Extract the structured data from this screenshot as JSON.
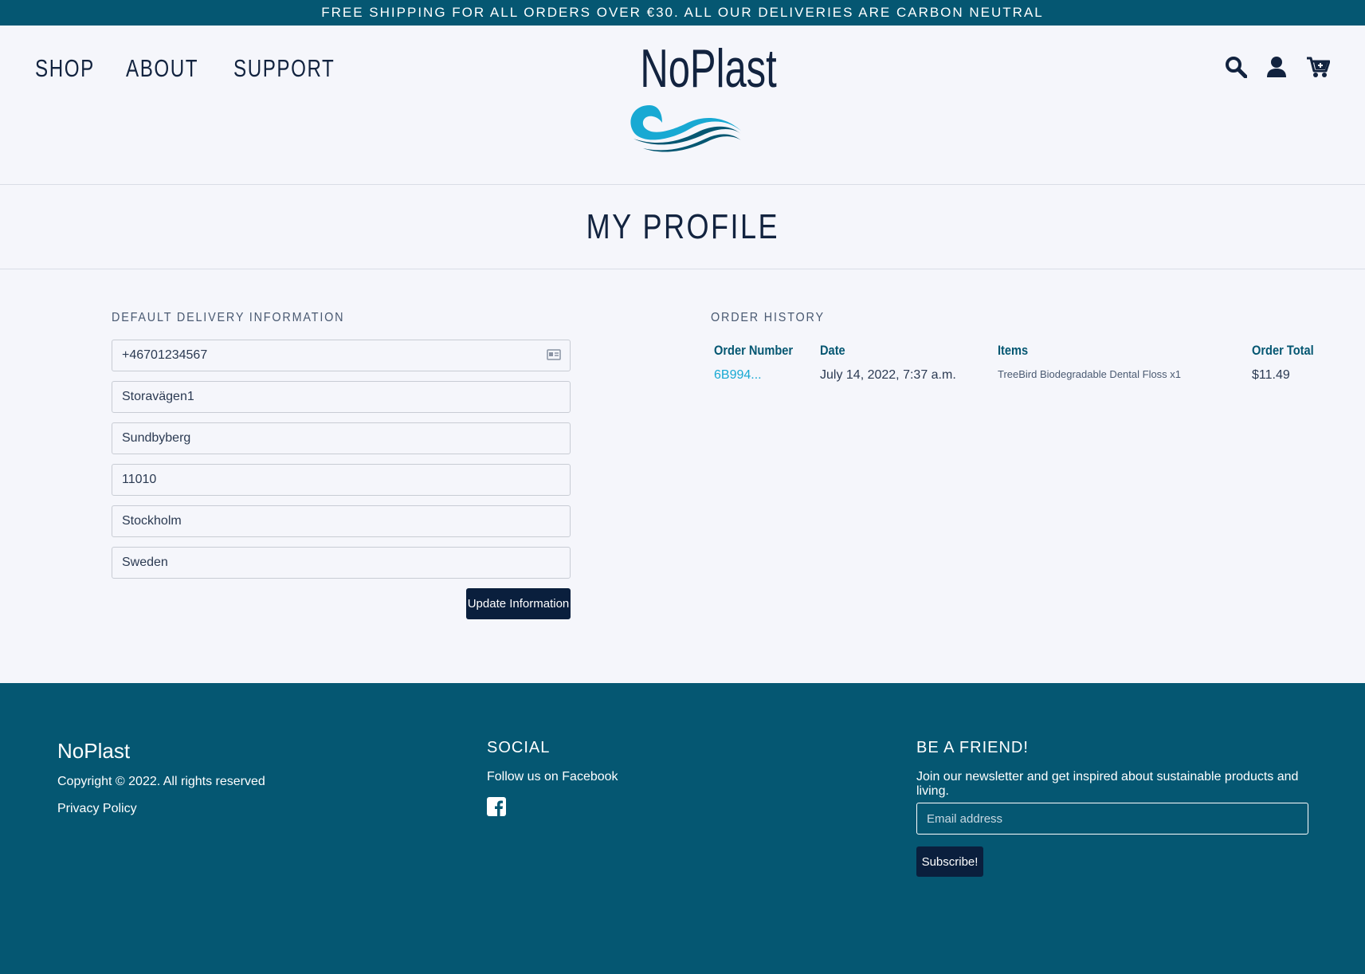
{
  "banner": {
    "text": "FREE SHIPPING FOR ALL ORDERS OVER €30. ALL OUR DELIVERIES ARE CARBON NEUTRAL"
  },
  "nav": {
    "shop": "SHOP",
    "about": "ABOUT",
    "support": "SUPPORT"
  },
  "logo": {
    "text": "NoPlast"
  },
  "icons": {
    "search": "search-icon",
    "account": "user-icon",
    "cart": "cart-icon"
  },
  "page": {
    "title": "MY PROFILE"
  },
  "delivery": {
    "heading": "DEFAULT DELIVERY INFORMATION",
    "phone": "+46701234567",
    "street": "Storavägen1",
    "town": "Sundbyberg",
    "postcode": "11010",
    "county": "Stockholm",
    "country": "Sweden",
    "update_label": "Update Information"
  },
  "orders": {
    "heading": "ORDER HISTORY",
    "columns": [
      "Order Number",
      "Date",
      "Items",
      "Order Total"
    ],
    "rows": [
      {
        "number": "6B994...",
        "date": "July 14, 2022, 7:37 a.m.",
        "items": "TreeBird Biodegradable Dental Floss x1",
        "total": "$11.49"
      }
    ]
  },
  "footer": {
    "brand": "NoPlast",
    "copyright": "Copyright © 2022. All rights reserved",
    "privacy": "Privacy Policy",
    "social_heading": "SOCIAL",
    "social_text": "Follow us on Facebook",
    "friend_heading": "BE A FRIEND!",
    "friend_text": "Join our newsletter and get inspired about sustainable products and living.",
    "email_placeholder": "Email address",
    "subscribe_label": "Subscribe!"
  },
  "colors": {
    "primary": "#055772",
    "dark": "#0a1f3d",
    "accent": "#18a9d3",
    "background": "#f5f6fb"
  }
}
